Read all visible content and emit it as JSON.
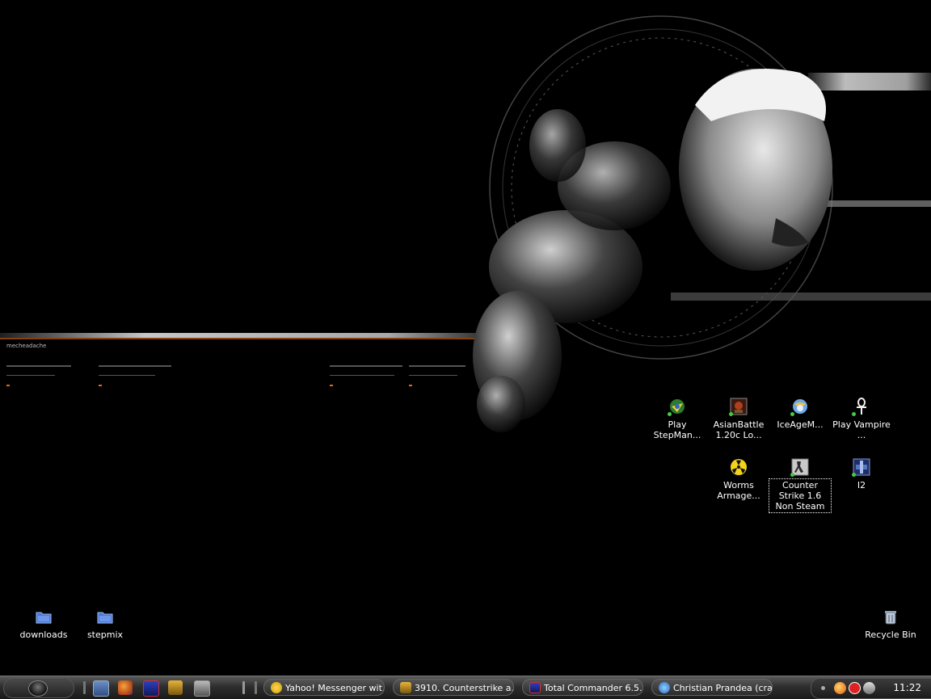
{
  "desktop": {
    "icons": [
      {
        "name": "desktop-icon-play-stepmania",
        "label": "Play StepMan...",
        "icon": "stepmania-icon"
      },
      {
        "name": "desktop-icon-asianbattle",
        "label": "AsianBattle 1.20c Lo...",
        "icon": "asianbattle-icon"
      },
      {
        "name": "desktop-icon-iceage",
        "label": "IceAgeM...",
        "icon": "iceage-icon"
      },
      {
        "name": "desktop-icon-play-vampire",
        "label": "Play Vampire ...",
        "icon": "ankh-icon"
      },
      {
        "name": "desktop-icon-worms",
        "label": "Worms Armage...",
        "icon": "radiation-icon"
      },
      {
        "name": "desktop-icon-counter-strike",
        "label": "Counter Strike 1.6 Non Steam",
        "icon": "counter-strike-icon"
      },
      {
        "name": "desktop-icon-i2",
        "label": "I2",
        "icon": "i2-icon"
      },
      {
        "name": "desktop-icon-downloads",
        "label": "downloads",
        "icon": "folder-icon"
      },
      {
        "name": "desktop-icon-stepmix",
        "label": "stepmix",
        "icon": "folder-icon"
      },
      {
        "name": "desktop-icon-recycle-bin",
        "label": "Recycle Bin",
        "icon": "recycle-bin-icon"
      }
    ],
    "wallpaper_text": "mecheadache"
  },
  "taskbar": {
    "quick_launch": [
      "show-desktop-icon",
      "firefox-icon",
      "total-commander-icon",
      "winamp-icon",
      "media-icon"
    ],
    "tasks": [
      {
        "label": "Yahoo! Messenger wit...",
        "icon": "yahoo-icon"
      },
      {
        "label": "3910. Counterstrike a...",
        "icon": "winamp-icon"
      },
      {
        "label": "Total Commander 6.5...",
        "icon": "total-commander-icon"
      },
      {
        "label": "Christian Prandea (cra...",
        "icon": "browser-icon"
      }
    ],
    "clock": "11:22"
  },
  "colors": {
    "accent_orange": "#e06a1a",
    "taskbar_dark": "#2a2a2a"
  }
}
